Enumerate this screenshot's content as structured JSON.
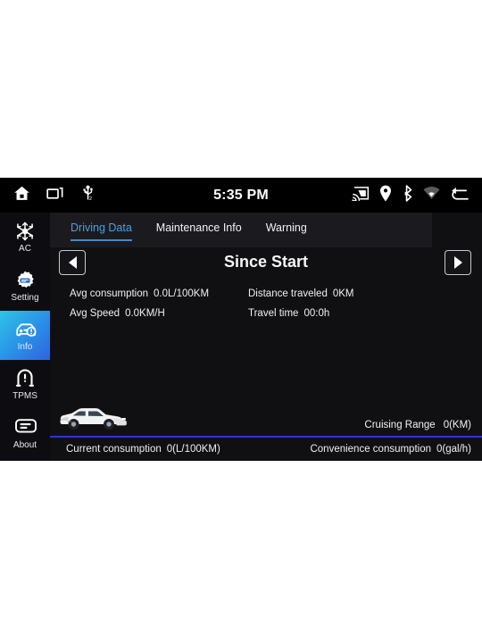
{
  "statusbar": {
    "time": "5:35 PM",
    "left_icons": [
      {
        "name": "home-icon"
      },
      {
        "name": "recent-apps-icon"
      },
      {
        "name": "usb-icon"
      }
    ],
    "right_icons": [
      {
        "name": "cast-icon"
      },
      {
        "name": "location-pin-icon"
      },
      {
        "name": "bluetooth-icon"
      },
      {
        "name": "wifi-icon"
      },
      {
        "name": "back-icon"
      }
    ]
  },
  "sidebar": {
    "items": [
      {
        "label": "AC",
        "icon": "snowflake-icon",
        "active": false
      },
      {
        "label": "Setting",
        "icon": "gear-icon",
        "active": false
      },
      {
        "label": "Info",
        "icon": "car-info-icon",
        "active": true
      },
      {
        "label": "TPMS",
        "icon": "tire-pressure-icon",
        "active": false
      },
      {
        "label": "About",
        "icon": "info-card-icon",
        "active": false
      }
    ]
  },
  "main": {
    "tabs": [
      {
        "label": "Driving Data",
        "active": true
      },
      {
        "label": "Maintenance Info",
        "active": false
      },
      {
        "label": "Warning",
        "active": false
      }
    ],
    "title": "Since Start",
    "prev_label": "Previous",
    "next_label": "Next",
    "stats": [
      [
        {
          "label": "Avg consumption",
          "value": "0.0L/100KM"
        },
        {
          "label": "Distance traveled",
          "value": "0KM"
        }
      ],
      [
        {
          "label": "Avg Speed",
          "value": "0.0KM/H"
        },
        {
          "label": "Travel time",
          "value": "00:0h"
        }
      ]
    ],
    "cruising": {
      "label": "Cruising Range",
      "value": "0(KM)"
    },
    "current_consumption": {
      "label": "Current consumption",
      "value": "0(L/100KM)"
    },
    "convenience_consumption": {
      "label": "Convenience consumption",
      "value": "0(gal/h)"
    },
    "vehicle_image": "white-hatchback-car"
  },
  "colors": {
    "accent_blue": "#4a9ee8",
    "divider_blue": "#2b35d8",
    "active_gradient_start": "#2ec5e8",
    "active_gradient_end": "#2f63e0",
    "screen_bg": "#101013",
    "statusbar_bg": "#000000"
  }
}
